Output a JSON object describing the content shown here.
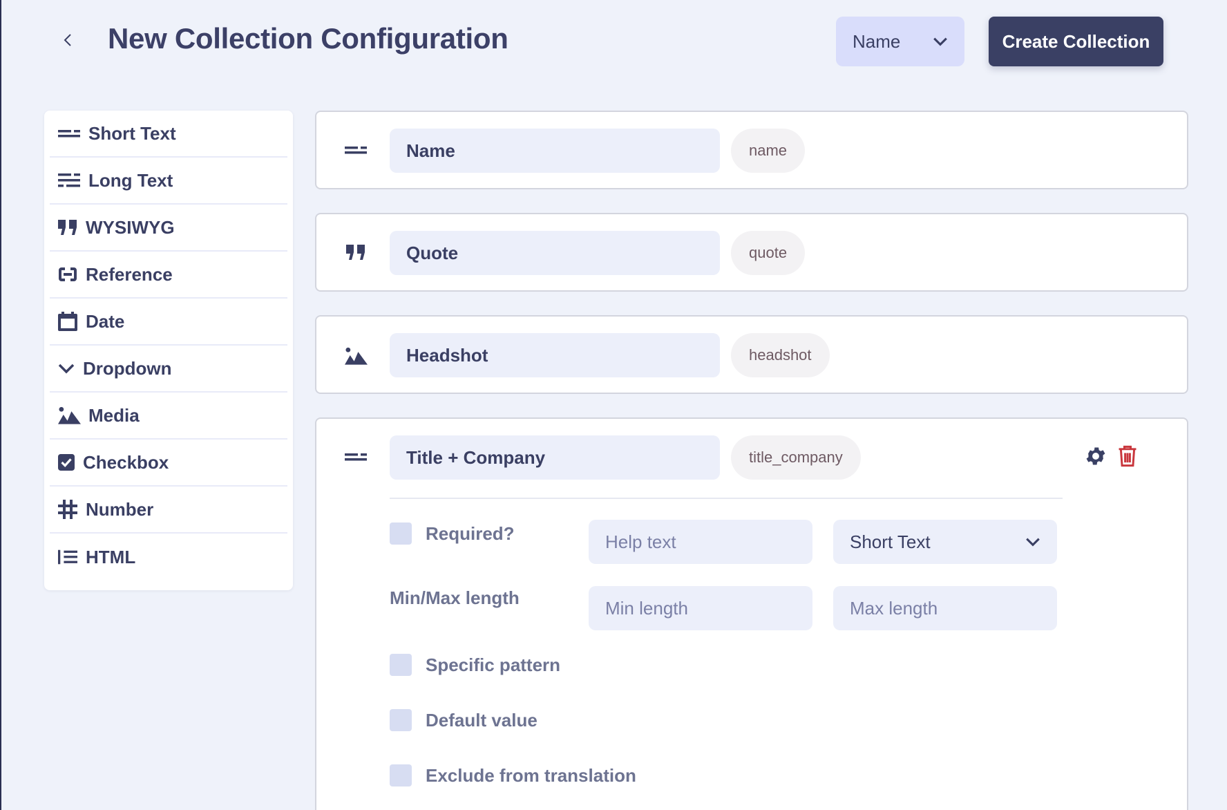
{
  "header": {
    "title": "New Collection Configuration",
    "back_icon": "chevron-left-icon",
    "display_field_select": {
      "value": "Name",
      "icon": "chevron-down-icon"
    },
    "create_button": "Create Collection"
  },
  "palette": {
    "items": [
      {
        "label": "Short Text",
        "icon": "short-text-icon"
      },
      {
        "label": "Long Text",
        "icon": "long-text-icon"
      },
      {
        "label": "WYSIWYG",
        "icon": "quote-icon"
      },
      {
        "label": "Reference",
        "icon": "link-icon"
      },
      {
        "label": "Date",
        "icon": "calendar-icon"
      },
      {
        "label": "Dropdown",
        "icon": "chevron-down-icon"
      },
      {
        "label": "Media",
        "icon": "image-icon"
      },
      {
        "label": "Checkbox",
        "icon": "checkbox-icon"
      },
      {
        "label": "Number",
        "icon": "hash-icon"
      },
      {
        "label": "HTML",
        "icon": "list-icon"
      }
    ]
  },
  "fields": [
    {
      "label": "Name",
      "key": "name",
      "icon": "short-text-icon"
    },
    {
      "label": "Quote",
      "key": "quote",
      "icon": "quote-icon"
    },
    {
      "label": "Headshot",
      "key": "headshot",
      "icon": "image-icon"
    },
    {
      "label": "Title + Company",
      "key": "title_company",
      "icon": "short-text-icon",
      "expanded": true,
      "actions": {
        "settings_icon": "gear-icon",
        "delete_icon": "trash-icon",
        "delete_color": "#c9373d"
      },
      "config": {
        "required_label": "Required?",
        "required_checked": false,
        "help_text_placeholder": "Help text",
        "help_text_value": "",
        "type_select_value": "Short Text",
        "minmax_label": "Min/Max length",
        "min_placeholder": "Min length",
        "max_placeholder": "Max length",
        "specific_pattern_label": "Specific pattern",
        "specific_pattern_checked": false,
        "default_value_label": "Default value",
        "default_value_checked": false,
        "exclude_translation_label": "Exclude from translation",
        "exclude_translation_checked": false
      }
    }
  ],
  "colors": {
    "background": "#eff2fa",
    "primary_dark": "#3a4064",
    "input_bg": "#eceffa",
    "select_bg": "#d9ddfb",
    "danger": "#c9373d",
    "key_pill_text": "#6e5a63"
  }
}
